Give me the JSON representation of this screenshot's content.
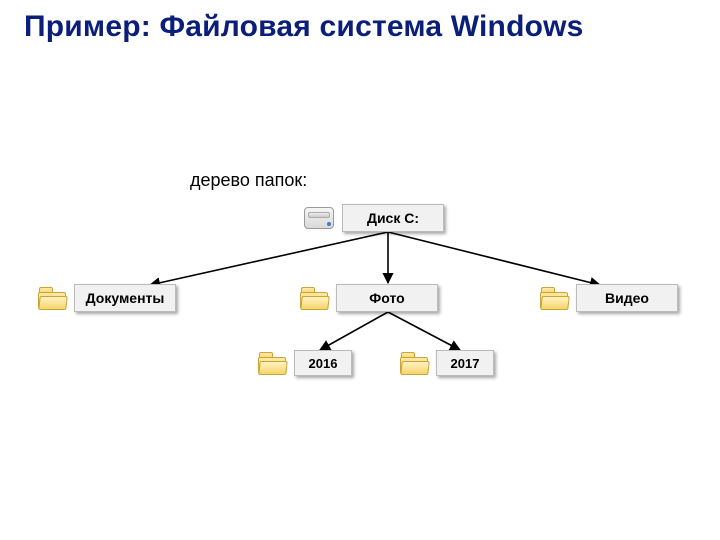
{
  "title": "Пример: Файловая система Windows",
  "subtitle": "дерево папок:",
  "root": {
    "label": "Диск C:"
  },
  "level1": {
    "documents": "Документы",
    "photo": "Фото",
    "video": "Видео"
  },
  "level2": {
    "y2016": "2016",
    "y2017": "2017"
  }
}
